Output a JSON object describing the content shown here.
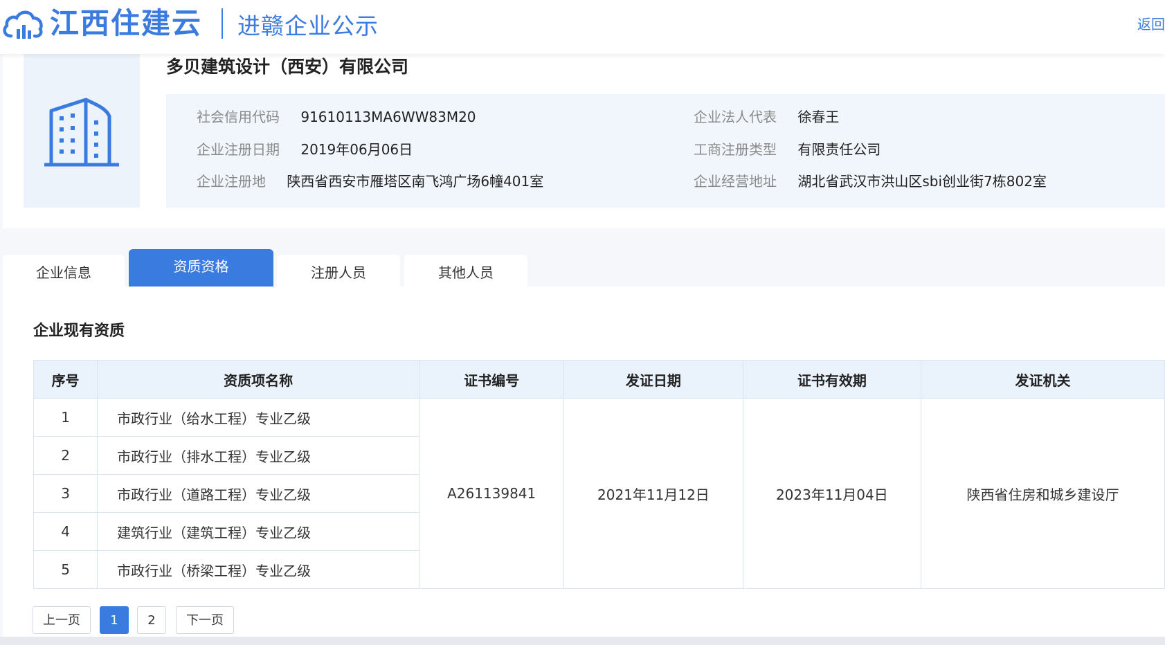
{
  "header": {
    "logo_text": "江西住建云",
    "logo_sub": "进赣企业公示",
    "back_label": "返回"
  },
  "company": {
    "name": "多贝建筑设计（西安）有限公司",
    "fields": {
      "credit_code_label": "社会信用代码",
      "credit_code_value": "91610113MA6WW83M20",
      "legal_rep_label": "企业法人代表",
      "legal_rep_value": "徐春王",
      "reg_date_label": "企业注册日期",
      "reg_date_value": "2019年06月06日",
      "biz_type_label": "工商注册类型",
      "biz_type_value": "有限责任公司",
      "reg_place_label": "企业注册地",
      "reg_place_value": "陕西省西安市雁塔区南飞鸿广场6幢401室",
      "biz_address_label": "企业经营地址",
      "biz_address_value": "湖北省武汉市洪山区sbi创业街7栋802室"
    }
  },
  "tabs": [
    {
      "label": "企业信息",
      "active": false
    },
    {
      "label": "资质资格",
      "active": true
    },
    {
      "label": "注册人员",
      "active": false
    },
    {
      "label": "其他人员",
      "active": false
    }
  ],
  "section_title": "企业现有资质",
  "table": {
    "headers": [
      "序号",
      "资质项名称",
      "证书编号",
      "发证日期",
      "证书有效期",
      "发证机关"
    ],
    "rows": [
      {
        "no": "1",
        "name": "市政行业（给水工程）专业乙级"
      },
      {
        "no": "2",
        "name": "市政行业（排水工程）专业乙级"
      },
      {
        "no": "3",
        "name": "市政行业（道路工程）专业乙级"
      },
      {
        "no": "4",
        "name": "建筑行业（建筑工程）专业乙级"
      },
      {
        "no": "5",
        "name": "市政行业（桥梁工程）专业乙级"
      }
    ],
    "merged": {
      "cert_no": "A261139841",
      "issue_date": "2021年11月12日",
      "valid_until": "2023年11月04日",
      "authority": "陕西省住房和城乡建设厅"
    }
  },
  "pagination": {
    "prev_label": "上一页",
    "pages": [
      "1",
      "2"
    ],
    "current": "1",
    "next_label": "下一页"
  },
  "colors": {
    "brand": "#3a7be0",
    "panel": "#f1f6fd",
    "table_header": "#eaf2fc"
  }
}
